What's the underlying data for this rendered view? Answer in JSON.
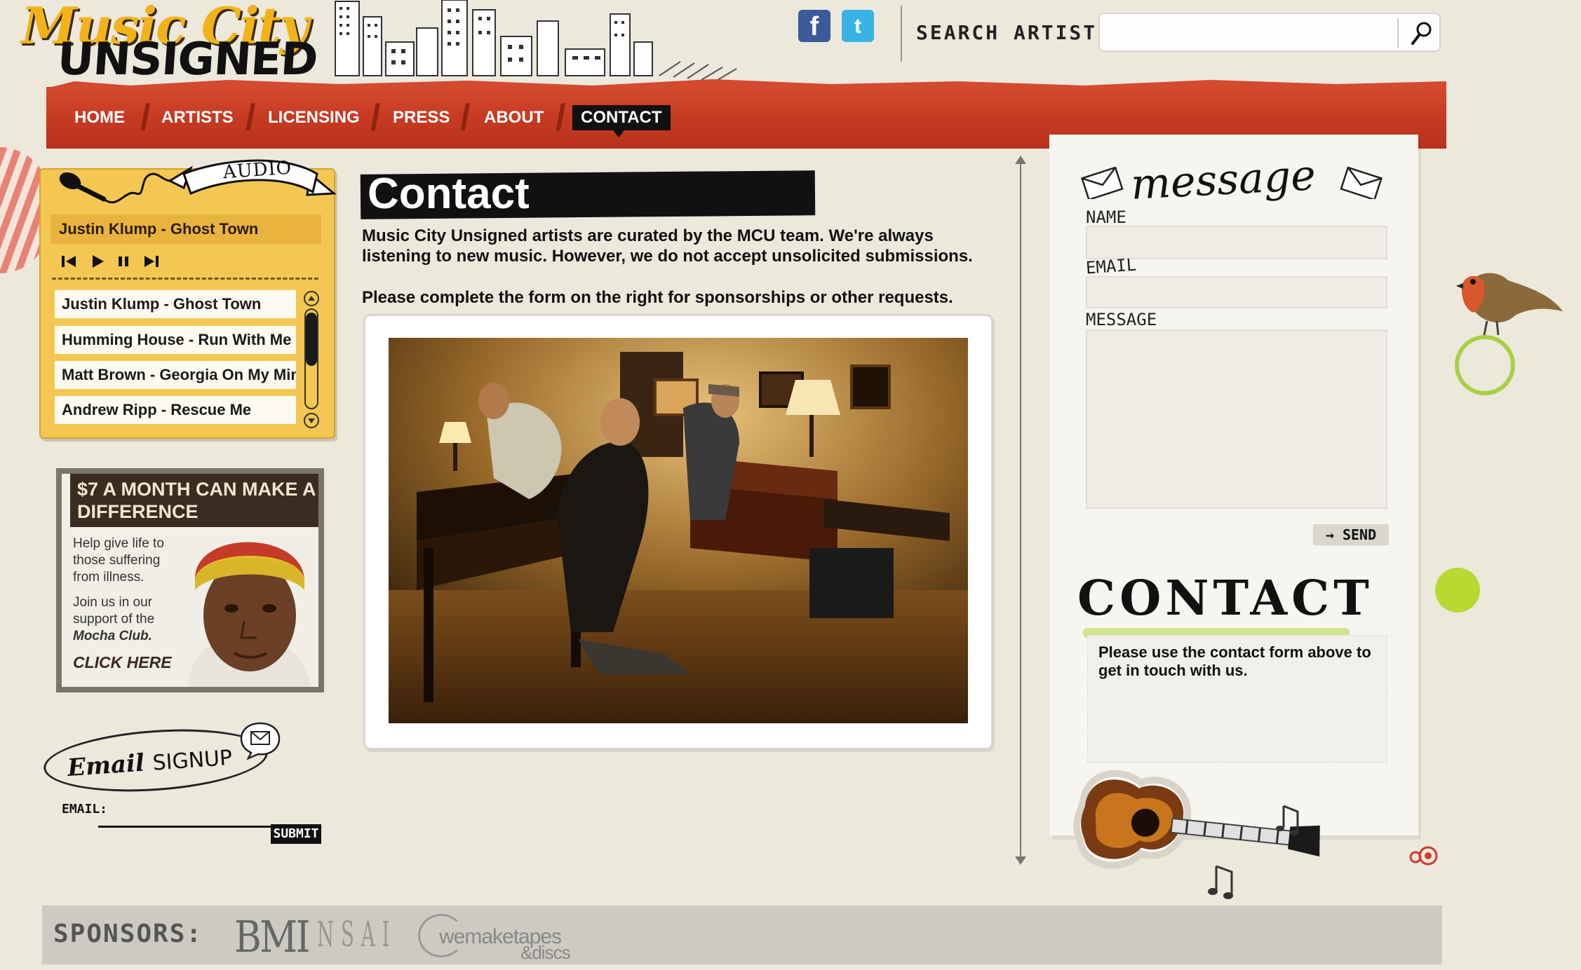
{
  "header": {
    "logo_line1": "Music City",
    "logo_line2": "UNSIGNED",
    "search_label": "SEARCH ARTISTS:",
    "search_placeholder": "",
    "social_icons": [
      "facebook-icon",
      "twitter-icon"
    ]
  },
  "nav": {
    "items": [
      "HOME",
      "ARTISTS",
      "LICENSING",
      "PRESS",
      "ABOUT",
      "CONTACT"
    ],
    "active": "CONTACT"
  },
  "audio": {
    "ribbon_label": "AUDIO",
    "now_playing": "Justin Klump - Ghost Town",
    "tracks": [
      "Justin Klump - Ghost Town",
      "Humming House - Run With Me",
      "Matt Brown - Georgia On My Mind",
      "Andrew Ripp - Rescue Me"
    ],
    "controls": [
      "prev-icon",
      "play-icon",
      "pause-icon",
      "next-icon"
    ]
  },
  "ad": {
    "headline": "$7 A MONTH CAN MAKE A DIFFERENCE",
    "body1": "Help give life to those suffering from illness.",
    "body2_prefix": "Join us in our support of the",
    "body2_bold": "Mocha Club.",
    "cta": "CLICK HERE"
  },
  "signup": {
    "title_script": "Email",
    "title_plain": "SIGNUP",
    "email_label": "EMAIL:",
    "submit_label": "SUBMIT"
  },
  "main": {
    "title": "Contact",
    "intro": "Music City Unsigned artists are curated by the MCU team. We're always listening to new music. However, we do not accept unsolicited submissions.",
    "intro2": "Please complete the form on the right for sponsorships or other requests."
  },
  "message_form": {
    "title": "message",
    "name_label": "NAME",
    "email_label": "EMAIL",
    "message_label": "MESSAGE",
    "send_label": "→ SEND"
  },
  "contact_note": {
    "heading": "CONTACT",
    "text": "Please use the contact form above to get in touch with us."
  },
  "sponsors": {
    "label": "SPONSORS:",
    "items": [
      "BMI",
      "NSAI",
      "wemaketapes",
      "&discs"
    ]
  },
  "colors": {
    "nav_red": "#c63a22",
    "audio_yellow": "#f3c752",
    "logo_gold": "#f2b319",
    "background": "#ece8dc",
    "accent_green": "#b8d932"
  }
}
